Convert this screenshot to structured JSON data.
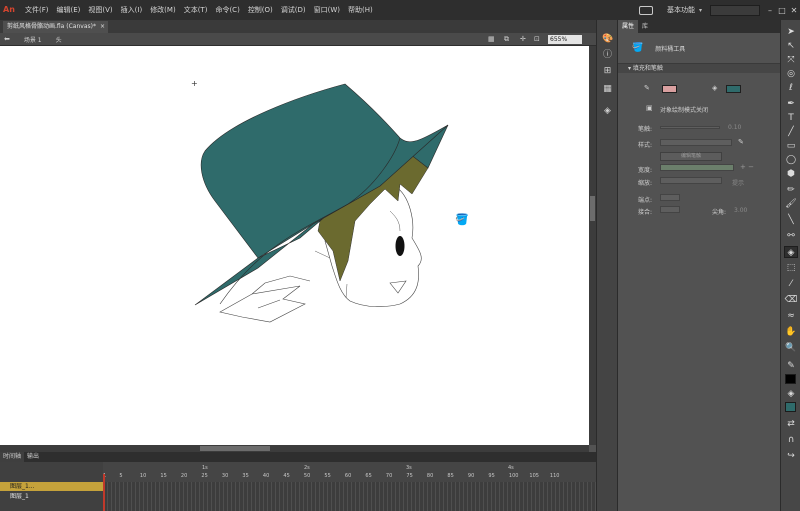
{
  "app": {
    "logo": "An",
    "menus": [
      "文件(F)",
      "编辑(E)",
      "视图(V)",
      "插入(I)",
      "修改(M)",
      "文本(T)",
      "命令(C)",
      "控制(O)",
      "调试(D)",
      "窗口(W)",
      "帮助(H)"
    ],
    "workspace": "基本功能",
    "window_controls": [
      "–",
      "□",
      "✕"
    ]
  },
  "document": {
    "tab_label": "剪纸风格骨骼动画.fla (Canvas)*",
    "tab_close": "×"
  },
  "editbar": {
    "scene": "场景 1",
    "breadcrumb": "头",
    "zoom": "655%"
  },
  "stage": {
    "crosshair": "+",
    "colors": {
      "hat": "#2f6b6b",
      "hair": "#6b6a2f",
      "face": "#ffffff",
      "outline": "#333333"
    }
  },
  "timeline": {
    "tabs": [
      "时间轴",
      "输出"
    ],
    "active_tab": "时间轴",
    "header_left": "帧:",
    "seconds": [
      "1s",
      "2s",
      "3s",
      "4s"
    ],
    "frame_ticks": [
      "1",
      "5",
      "10",
      "15",
      "20",
      "25",
      "30",
      "35",
      "40",
      "45",
      "50",
      "55",
      "60",
      "65",
      "70",
      "75",
      "80",
      "85",
      "90",
      "95",
      "100",
      "105",
      "110"
    ],
    "layers": [
      {
        "name": "图层_1...",
        "selected": true
      },
      {
        "name": "图层_1",
        "selected": false
      }
    ]
  },
  "properties": {
    "tabs": [
      "属性",
      "库"
    ],
    "tool_name": "颜料桶工具",
    "section": "填充和笔触",
    "object_draw": "对象绘制模式关闭",
    "stroke_label": "笔触:",
    "stroke_value": "0.10",
    "style_label": "样式:",
    "edit_style_btn": "编辑笔触",
    "width_label": "宽度:",
    "scale_label": "缩放:",
    "hint_label": "提示",
    "cap_label": "端点:",
    "join_label": "接合:",
    "miter_label": "尖角:",
    "miter_value": "3.00",
    "fill_color": "#2f6b6b",
    "stroke_color": "#d9a0a0"
  },
  "tools": {
    "stroke_swatch": "#000000",
    "fill_swatch": "#2f6b6b"
  }
}
